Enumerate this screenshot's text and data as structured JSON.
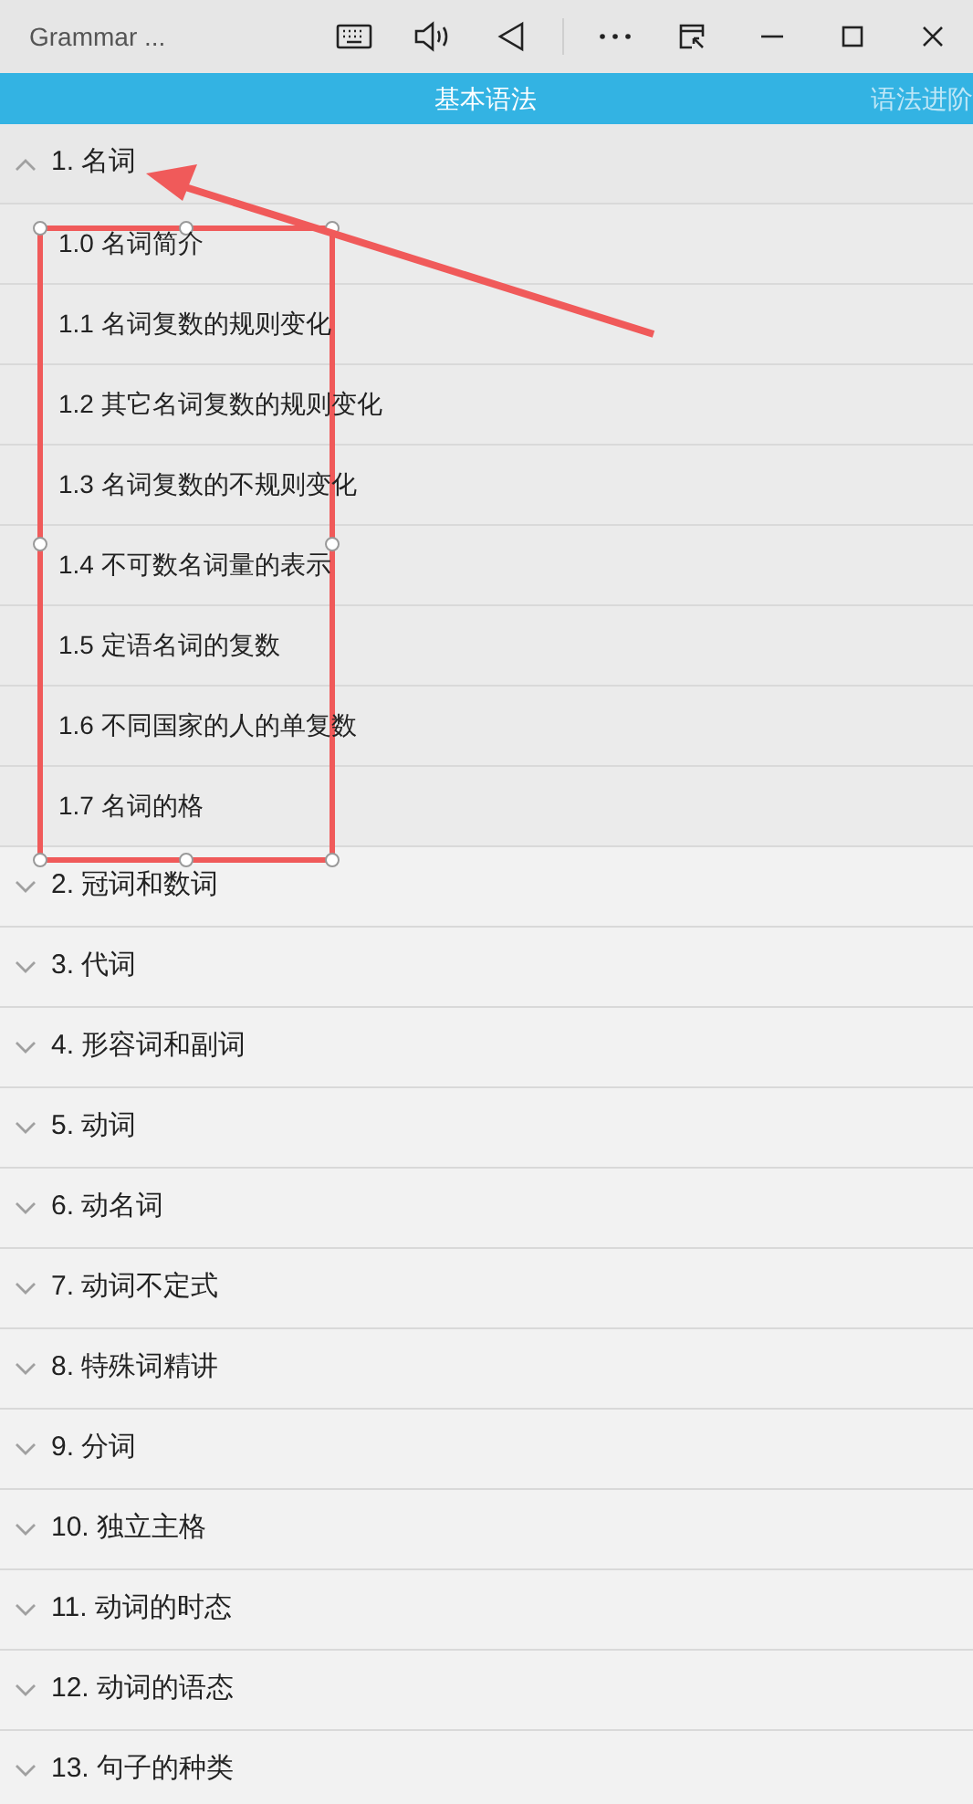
{
  "window": {
    "title": "Grammar ..."
  },
  "tabs": [
    {
      "label": "基本语法",
      "selected": true
    },
    {
      "label": "语法进阶",
      "selected": false
    }
  ],
  "groups": [
    {
      "label": "1. 名词",
      "expanded": true,
      "children": [
        "1.0 名词简介",
        "1.1 名词复数的规则变化",
        "1.2 其它名词复数的规则变化",
        "1.3 名词复数的不规则变化",
        "1.4 不可数名词量的表示",
        "1.5 定语名词的复数",
        "1.6 不同国家的人的单复数",
        "1.7 名词的格"
      ]
    },
    {
      "label": "2. 冠词和数词",
      "expanded": false
    },
    {
      "label": "3. 代词",
      "expanded": false
    },
    {
      "label": "4. 形容词和副词",
      "expanded": false
    },
    {
      "label": "5. 动词",
      "expanded": false
    },
    {
      "label": "6. 动名词",
      "expanded": false
    },
    {
      "label": "7. 动词不定式",
      "expanded": false
    },
    {
      "label": "8. 特殊词精讲",
      "expanded": false
    },
    {
      "label": "9. 分词",
      "expanded": false
    },
    {
      "label": "10. 独立主格",
      "expanded": false
    },
    {
      "label": "11. 动词的时态",
      "expanded": false
    },
    {
      "label": "12. 动词的语态",
      "expanded": false
    },
    {
      "label": "13. 句子的种类",
      "expanded": false
    }
  ]
}
